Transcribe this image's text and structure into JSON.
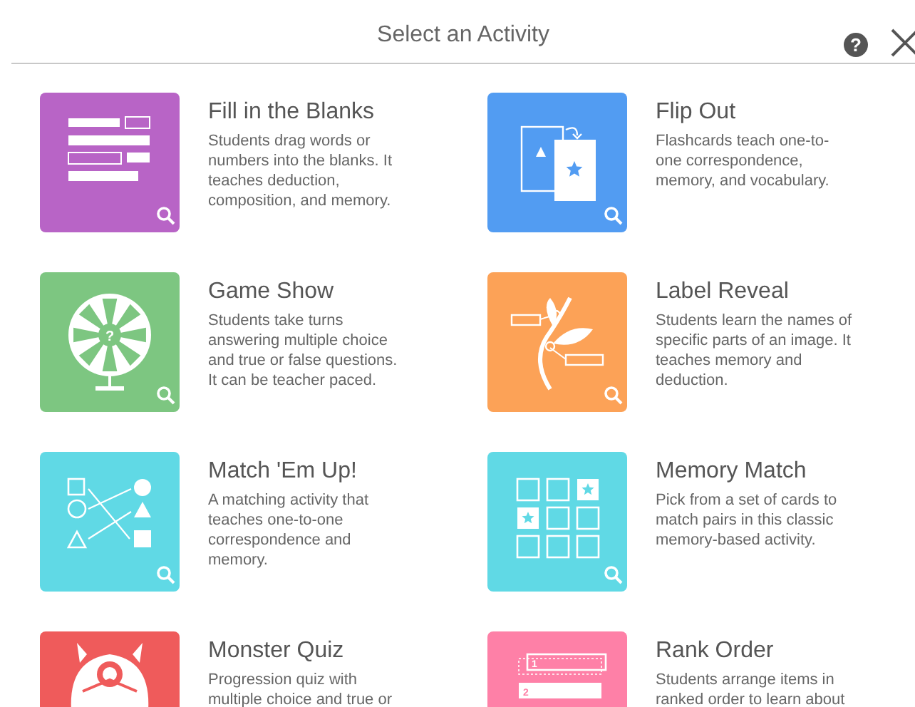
{
  "dialog": {
    "title": "Select an Activity",
    "help_label": "?"
  },
  "activities": [
    {
      "kind": "fill-blanks",
      "title": "Fill in the Blanks",
      "description": "Students drag words or numbers into the blanks. It teaches deduction, composition, and memory.",
      "color": "#b864c6"
    },
    {
      "kind": "flip-out",
      "title": "Flip Out",
      "description": "Flashcards teach one-to-one correspondence, memory, and vocabulary.",
      "color": "#529cf2"
    },
    {
      "kind": "game-show",
      "title": "Game Show",
      "description": "Students take turns answering multiple choice and true or false questions. It can be teacher paced.",
      "color": "#7dc681",
      "icon_text": [
        "?"
      ]
    },
    {
      "kind": "label-reveal",
      "title": "Label Reveal",
      "description": "Students learn the names of specific parts of an image. It teaches memory and deduction.",
      "color": "#fca257"
    },
    {
      "kind": "match-up",
      "title": "Match 'Em Up!",
      "description": "A matching activity that teaches one-to-one correspondence and memory.",
      "color": "#60d9e5"
    },
    {
      "kind": "memory-match",
      "title": "Memory Match",
      "description": "Pick from a set of cards to match pairs in this classic memory-based activity.",
      "color": "#60d9e5"
    },
    {
      "kind": "monster-quiz",
      "title": "Monster Quiz",
      "description": "Progression quiz with multiple choice and true or",
      "color": "#ef5b5b"
    },
    {
      "kind": "rank-order",
      "title": "Rank Order",
      "description": "Students arrange items in ranked order to learn about",
      "color": "#fe80a7",
      "icon_text": [
        "1",
        "2"
      ]
    }
  ]
}
